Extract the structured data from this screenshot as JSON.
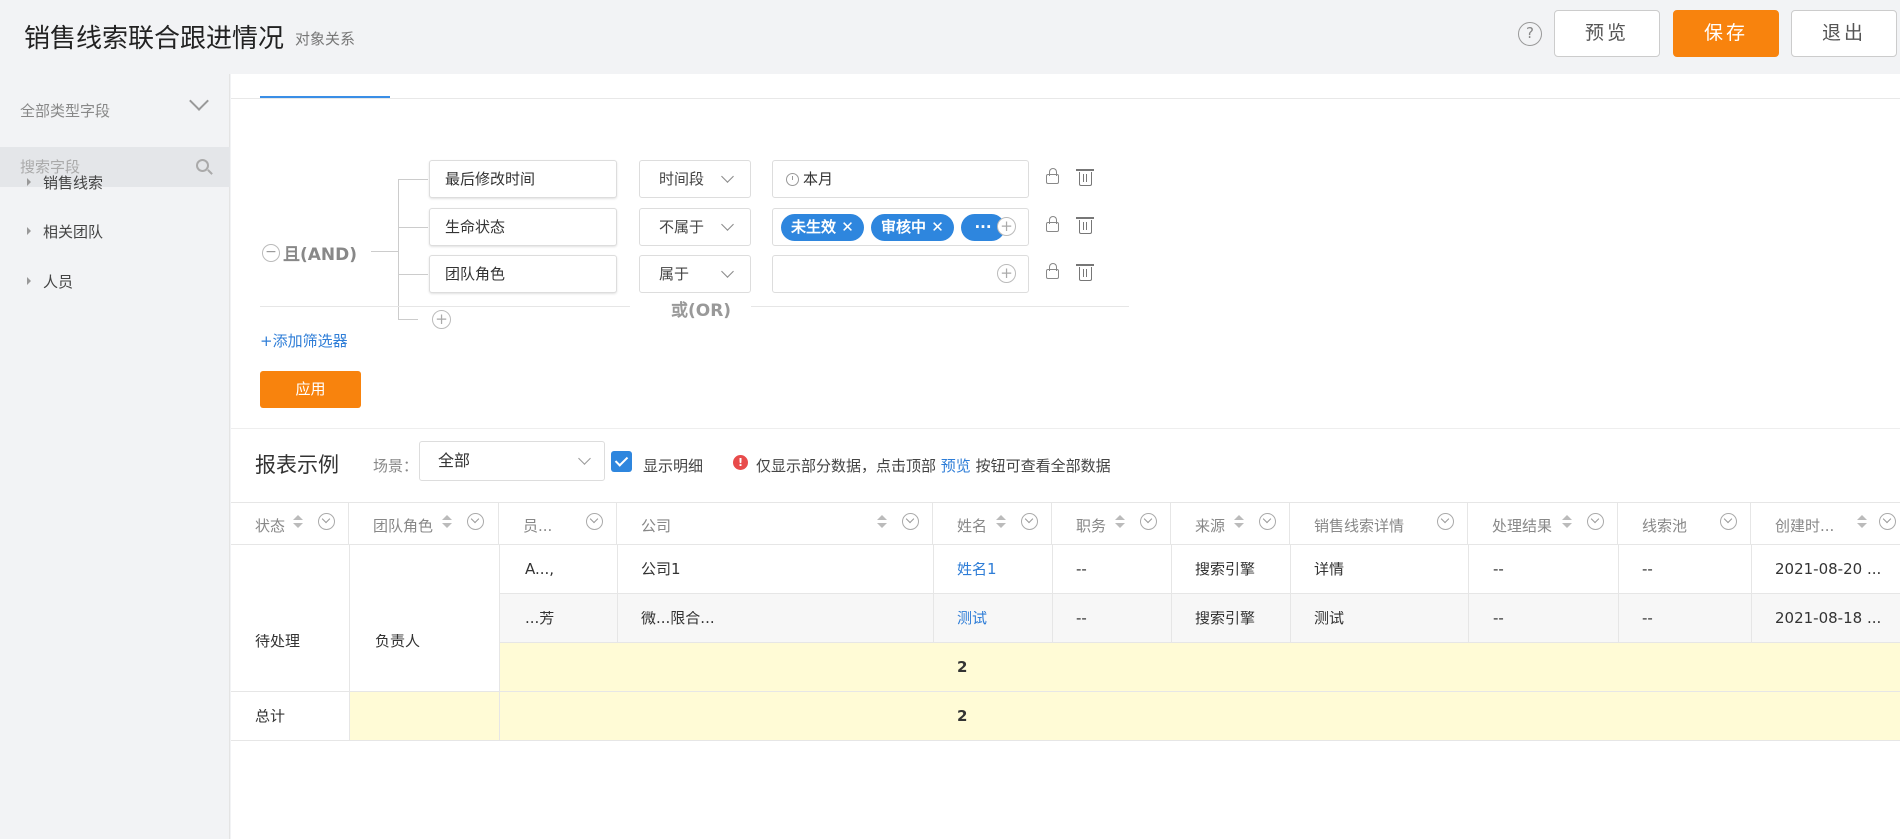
{
  "header": {
    "title": "销售线索联合跟进情况",
    "subtitle": "对象关系",
    "help_glyph": "?",
    "preview_label": "预览",
    "save_label": "保存",
    "exit_label": "退出"
  },
  "sidebar": {
    "field_type": "全部类型字段",
    "search_placeholder": "搜索字段",
    "items": [
      {
        "label": "销售线索"
      },
      {
        "label": "相关团队"
      },
      {
        "label": "人员"
      }
    ]
  },
  "filter": {
    "group_label": "且(AND)",
    "conditions": [
      {
        "field": "最后修改时间",
        "operator": "时间段",
        "value": "本月"
      },
      {
        "field": "生命状态",
        "operator": "不属于",
        "tags": [
          "未生效 ✕",
          "审核中 ✕",
          "···"
        ]
      },
      {
        "field": "团队角色",
        "operator": "属于",
        "value": ""
      }
    ],
    "or_label": "或(OR)",
    "add_filter_label": "+添加筛选器",
    "apply_label": "应用"
  },
  "report": {
    "title": "报表示例",
    "scene_label": "场景：",
    "scene_value": "全部",
    "show_detail_label": "显示明细",
    "notice_prefix": "仅显示部分数据，点击顶部",
    "notice_link": "预览",
    "notice_suffix": "按钮可查看全部数据",
    "columns": [
      "状态",
      "团队角色",
      "员...",
      "公司",
      "姓名",
      "职务",
      "来源",
      "销售线索详情",
      "处理结果",
      "线索池",
      "创建时..."
    ],
    "group_status": "待处理",
    "group_role": "负责人",
    "rows": [
      {
        "employee": "A...,",
        "company": "公司1",
        "name": "姓名1",
        "title": "--",
        "source": "搜索引擎",
        "detail": "详情",
        "result": "--",
        "pool": "--",
        "created": "2021-08-20 ..."
      },
      {
        "employee": "...芳",
        "company": "微...限合...",
        "name": "测试",
        "title": "--",
        "source": "搜索引擎",
        "detail": "测试",
        "result": "--",
        "pool": "--",
        "created": "2021-08-18 ..."
      }
    ],
    "subtotal": "2",
    "total_label": "总计",
    "total": "2"
  }
}
